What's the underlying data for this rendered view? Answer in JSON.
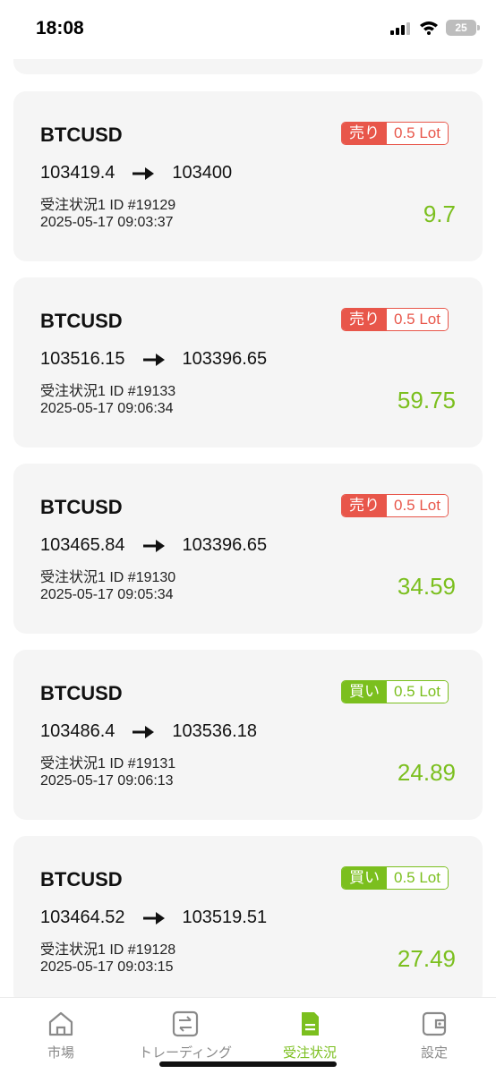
{
  "status": {
    "time": "18:08",
    "battery": "25"
  },
  "colors": {
    "sell": "#e8564a",
    "buy": "#7bbf1e",
    "profit": "#7bbf1e"
  },
  "orders": [
    {
      "symbol": "BTCUSD",
      "side": "売り",
      "lot": "0.5 Lot",
      "open": "103419.4",
      "close": "103400",
      "order_id": "受注状況1 ID #19129",
      "datetime": "2025-05-17 09:03:37",
      "pnl": "9.7"
    },
    {
      "symbol": "BTCUSD",
      "side": "売り",
      "lot": "0.5 Lot",
      "open": "103516.15",
      "close": "103396.65",
      "order_id": "受注状況1 ID #19133",
      "datetime": "2025-05-17 09:06:34",
      "pnl": "59.75"
    },
    {
      "symbol": "BTCUSD",
      "side": "売り",
      "lot": "0.5 Lot",
      "open": "103465.84",
      "close": "103396.65",
      "order_id": "受注状況1 ID #19130",
      "datetime": "2025-05-17 09:05:34",
      "pnl": "34.59"
    },
    {
      "symbol": "BTCUSD",
      "side": "買い",
      "lot": "0.5 Lot",
      "open": "103486.4",
      "close": "103536.18",
      "order_id": "受注状況1 ID #19131",
      "datetime": "2025-05-17 09:06:13",
      "pnl": "24.89"
    },
    {
      "symbol": "BTCUSD",
      "side": "買い",
      "lot": "0.5 Lot",
      "open": "103464.52",
      "close": "103519.51",
      "order_id": "受注状況1 ID #19128",
      "datetime": "2025-05-17 09:03:15",
      "pnl": "27.49"
    }
  ],
  "tabbar": {
    "items": [
      {
        "label": "市場",
        "icon": "home-icon"
      },
      {
        "label": "トレーディング",
        "icon": "swap-icon"
      },
      {
        "label": "受注状況",
        "icon": "document-icon",
        "active": true
      },
      {
        "label": "設定",
        "icon": "wallet-icon"
      }
    ]
  }
}
